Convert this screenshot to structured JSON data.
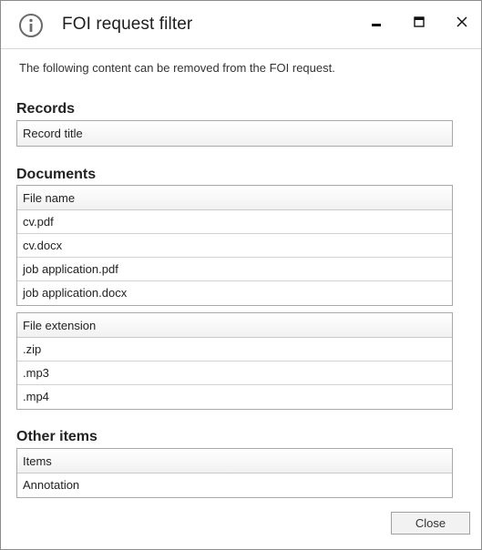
{
  "window": {
    "title": "FOI request filter",
    "icon": "info-icon"
  },
  "description": "The following content can be removed from the FOI request.",
  "records": {
    "section_title": "Records",
    "header": "Record title",
    "rows": []
  },
  "documents": {
    "section_title": "Documents",
    "file_names": {
      "header": "File name",
      "rows": [
        "cv.pdf",
        "cv.docx",
        "job application.pdf",
        "job application.docx"
      ]
    },
    "file_extensions": {
      "header": "File extension",
      "rows": [
        ".zip",
        ".mp3",
        ".mp4"
      ]
    }
  },
  "other_items": {
    "section_title": "Other items",
    "header": "Items",
    "rows": [
      "Annotation"
    ]
  },
  "buttons": {
    "close_label": "Close"
  }
}
